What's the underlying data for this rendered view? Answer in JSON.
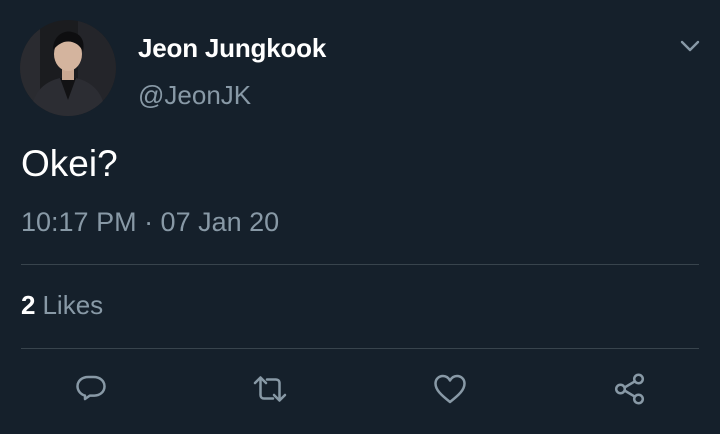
{
  "tweet": {
    "author": {
      "display_name": "Jeon Jungkook",
      "handle": "@JeonJK"
    },
    "text": "Okei?",
    "timestamp": "10:17 PM · 07 Jan 20",
    "likes": {
      "count": "2",
      "label": "Likes"
    }
  },
  "icons": {
    "menu": "chevron-down-icon",
    "reply": "reply-icon",
    "retweet": "retweet-icon",
    "like": "heart-icon",
    "share": "share-icon"
  },
  "colors": {
    "background": "#15202b",
    "primary_text": "#ffffff",
    "secondary_text": "#8899a6",
    "divider": "#38444d"
  }
}
